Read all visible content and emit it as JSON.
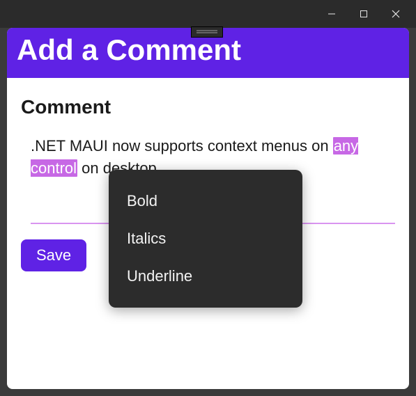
{
  "header": {
    "title": "Add a Comment"
  },
  "section": {
    "title": "Comment"
  },
  "editor": {
    "text_before": ".NET MAUI now supports context menus on ",
    "text_selected": "any control",
    "text_after": " on desktop."
  },
  "buttons": {
    "save": "Save"
  },
  "context_menu": {
    "items": [
      {
        "label": "Bold"
      },
      {
        "label": "Italics"
      },
      {
        "label": "Underline"
      }
    ]
  }
}
